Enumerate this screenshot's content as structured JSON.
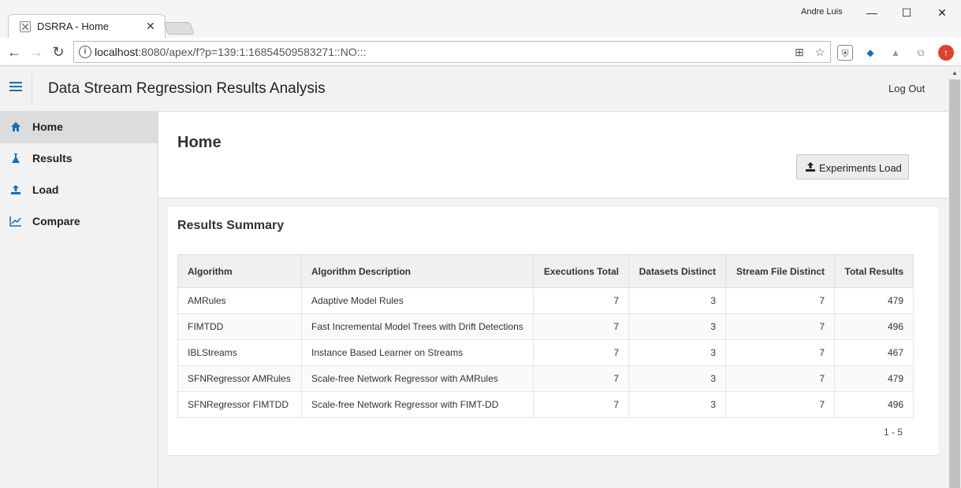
{
  "browser": {
    "tab_title": "DSRRA - Home",
    "user_name": "Andre Luis",
    "url_host": "localhost",
    "url_rest": ":8080/apex/f?p=139:1:16854509583271::NO:::"
  },
  "header": {
    "app_title": "Data Stream Regression Results Analysis",
    "logout_label": "Log Out"
  },
  "sidebar": {
    "items": [
      {
        "label": "Home",
        "icon": "home-icon"
      },
      {
        "label": "Results",
        "icon": "flask-icon"
      },
      {
        "label": "Load",
        "icon": "upload-icon"
      },
      {
        "label": "Compare",
        "icon": "line-chart-icon"
      }
    ]
  },
  "page": {
    "title": "Home",
    "experiments_button": "Experiments Load"
  },
  "summary": {
    "title": "Results Summary",
    "columns": [
      "Algorithm",
      "Algorithm Description",
      "Executions Total",
      "Datasets Distinct",
      "Stream File Distinct",
      "Total Results"
    ],
    "rows": [
      [
        "AMRules",
        "Adaptive Model Rules",
        "7",
        "3",
        "7",
        "479"
      ],
      [
        "FIMTDD",
        "Fast Incremental Model Trees with Drift Detections",
        "7",
        "3",
        "7",
        "496"
      ],
      [
        "IBLStreams",
        "Instance Based Learner on Streams",
        "7",
        "3",
        "7",
        "467"
      ],
      [
        "SFNRegressor AMRules",
        "Scale-free Network Regressor with AMRules",
        "7",
        "3",
        "7",
        "479"
      ],
      [
        "SFNRegressor FIMTDD",
        "Scale-free Network Regressor with FIMT-DD",
        "7",
        "3",
        "7",
        "496"
      ]
    ],
    "pagination": "1 - 5"
  },
  "colors": {
    "accent": "#1a6eb0",
    "sidebar_active": "#dcdcdc"
  }
}
